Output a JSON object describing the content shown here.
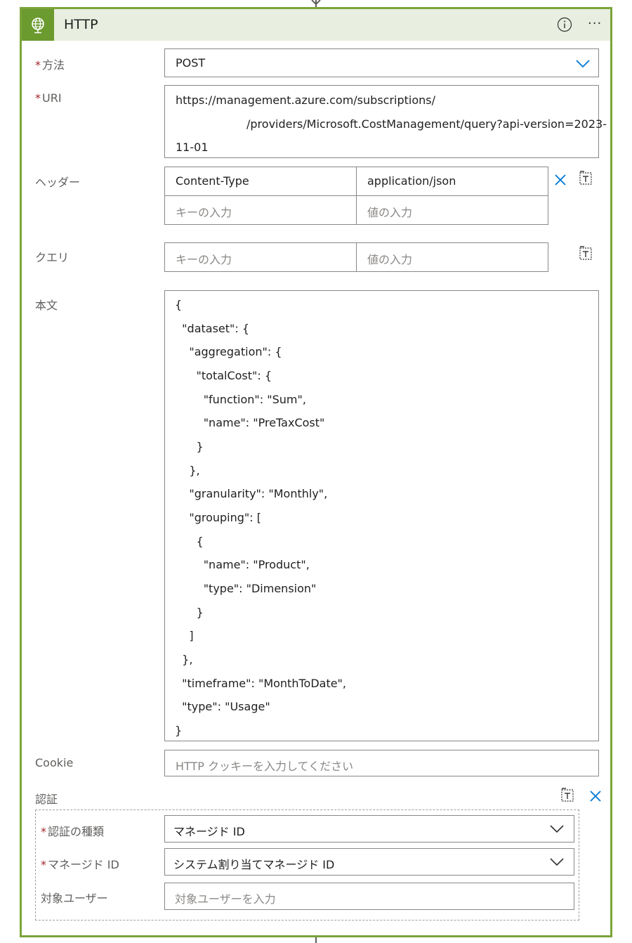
{
  "header": {
    "title": "HTTP",
    "icon": "globe-icon"
  },
  "method": {
    "label": "方法",
    "value": "POST"
  },
  "uri": {
    "label": "URI",
    "lines": [
      "https://management.azure.com/subscriptions/",
      "/providers/Microsoft.CostManagement/query?api-version=2023-",
      "11-01"
    ]
  },
  "headers": {
    "label": "ヘッダー",
    "rows": [
      {
        "key": "Content-Type",
        "value": "application/json"
      }
    ],
    "key_placeholder": "キーの入力",
    "value_placeholder": "値の入力"
  },
  "query": {
    "label": "クエリ",
    "key_placeholder": "キーの入力",
    "value_placeholder": "値の入力"
  },
  "body": {
    "label": "本文",
    "lines": [
      "{",
      "  \"dataset\": {",
      "    \"aggregation\": {",
      "      \"totalCost\": {",
      "        \"function\": \"Sum\",",
      "        \"name\": \"PreTaxCost\"",
      "      }",
      "    },",
      "    \"granularity\": \"Monthly\",",
      "    \"grouping\": [",
      "      {",
      "        \"name\": \"Product\",",
      "        \"type\": \"Dimension\"",
      "      }",
      "    ]",
      "  },",
      "  \"timeframe\": \"MonthToDate\",",
      "  \"type\": \"Usage\"",
      "}"
    ]
  },
  "cookie": {
    "label": "Cookie",
    "placeholder": "HTTP クッキーを入力してください"
  },
  "auth": {
    "label": "認証",
    "type_label": "認証の種類",
    "type_value": "マネージド ID",
    "managed_id_label": "マネージド ID",
    "managed_id_value": "システム割り当てマネージド ID",
    "audience_label": "対象ユーザー",
    "audience_placeholder": "対象ユーザーを入力"
  },
  "colors": {
    "accent": "#7aa43a",
    "link_blue": "#0078d4",
    "required": "#a4262c"
  }
}
